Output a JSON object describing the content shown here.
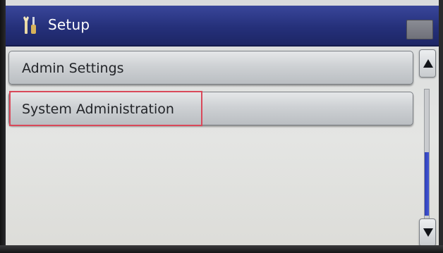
{
  "header": {
    "title": "Setup",
    "icon": "tools-icon"
  },
  "menu": {
    "items": [
      {
        "label": "Admin Settings",
        "selected": false
      },
      {
        "label": "System Administration",
        "selected": true
      }
    ]
  },
  "scrollbar": {
    "up_icon": "arrow-up-icon",
    "down_icon": "arrow-down-icon",
    "scroll_position": 0.65
  },
  "colors": {
    "header_blue": "#25307a",
    "selection_red": "#d9495a",
    "scroll_thumb_blue": "#3446c6"
  }
}
